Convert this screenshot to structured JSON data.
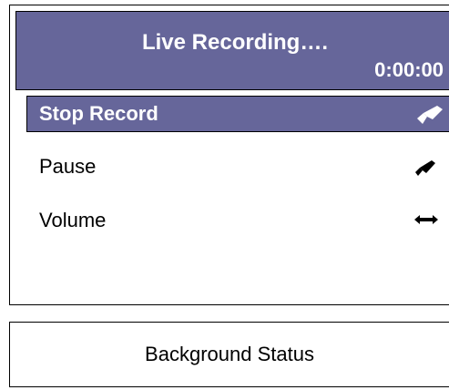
{
  "colors": {
    "accent": "#66669a",
    "text_on_accent": "#ffffff",
    "text": "#000000",
    "border": "#000000"
  },
  "header": {
    "title": "Live Recording….",
    "timer": "0:00:00"
  },
  "menu": {
    "items": [
      {
        "label": "Stop Record",
        "icon": "arrow-down-left-icon",
        "selected": true
      },
      {
        "label": "Pause",
        "icon": "arrow-down-left-icon",
        "selected": false
      },
      {
        "label": "Volume",
        "icon": "arrow-left-right-icon",
        "selected": false
      }
    ]
  },
  "status": {
    "label": "Background Status"
  }
}
